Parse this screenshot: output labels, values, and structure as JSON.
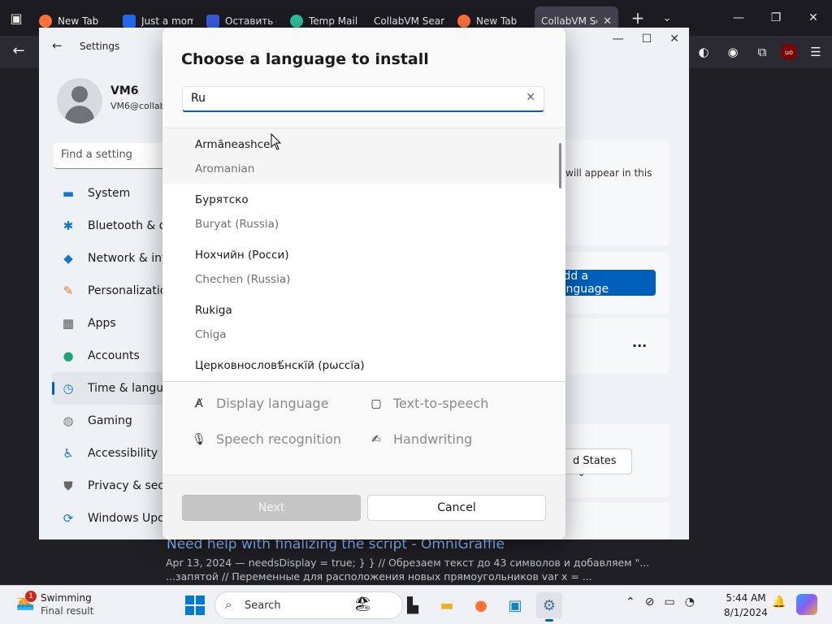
{
  "browser": {
    "tabs": [
      {
        "title": "New Tab",
        "color": "#ff7139"
      },
      {
        "title": "Just a moment...",
        "color": "#2563eb"
      },
      {
        "title": "Оставить с",
        "color": "#3b5bdb"
      },
      {
        "title": "Temp Mail",
        "color": "#2fbf9f"
      },
      {
        "title": "CollabVM Sear",
        "color": "#1c1b22"
      },
      {
        "title": "New Tab",
        "color": "#ff7139"
      },
      {
        "title": "CollabVM Se",
        "color": "#1c1b22"
      }
    ],
    "webpage": {
      "result_link": "Need help with finalizing the script - OmniGraffle",
      "result_snippet": "Apr 13, 2024 — needsDisplay = true; } } // Обрезаем текст до 43 символов и добавляем \"... ...запятой // Переменные для расположения новых прямоугольников var x = ..."
    }
  },
  "settings": {
    "window_title": "Settings",
    "user": {
      "name": "VM6",
      "email": "VM6@collab"
    },
    "find_placeholder": "Find a setting",
    "nav": [
      {
        "label": "System",
        "icon": "display-icon"
      },
      {
        "label": "Bluetooth & de",
        "icon": "bluetooth-icon"
      },
      {
        "label": "Network & inte",
        "icon": "wifi-icon"
      },
      {
        "label": "Personalization",
        "icon": "brush-icon"
      },
      {
        "label": "Apps",
        "icon": "apps-icon"
      },
      {
        "label": "Accounts",
        "icon": "person-icon"
      },
      {
        "label": "Time & langua",
        "icon": "clock-globe-icon",
        "selected": true
      },
      {
        "label": "Gaming",
        "icon": "gamepad-icon"
      },
      {
        "label": "Accessibility",
        "icon": "accessibility-icon"
      },
      {
        "label": "Privacy & secu",
        "icon": "shield-icon"
      },
      {
        "label": "Windows Upda",
        "icon": "refresh-icon"
      }
    ],
    "card_text": "will appear in this",
    "add_language_label": "Add a language",
    "more_label": "···",
    "region_value": "d States"
  },
  "dialog": {
    "title": "Choose a language to install",
    "search_value": "Ru",
    "languages": [
      {
        "native": "Armãneashce",
        "english": "Aromanian"
      },
      {
        "native": "Бурятско",
        "english": "Buryat (Russia)"
      },
      {
        "native": "Нохчийн (Росси)",
        "english": "Chechen (Russia)"
      },
      {
        "native": "Rukiga",
        "english": "Chiga"
      },
      {
        "native": "Церковнословѣ́нскїй (рѡссїа)",
        "english": ""
      }
    ],
    "features": [
      {
        "label": "Display language",
        "icon": "display-language-icon"
      },
      {
        "label": "Text-to-speech",
        "icon": "text-to-speech-icon"
      },
      {
        "label": "Speech recognition",
        "icon": "microphone-icon"
      },
      {
        "label": "Handwriting",
        "icon": "handwriting-icon"
      }
    ],
    "next_label": "Next",
    "cancel_label": "Cancel"
  },
  "taskbar": {
    "weather_badge": "1",
    "weather_line1": "Swimming",
    "weather_line2": "Final result",
    "search_label": "Search",
    "time": "5:44 AM",
    "date": "8/1/2024"
  },
  "colors": {
    "accent": "#005fb8",
    "disabled_button": "#c6c6c6"
  }
}
